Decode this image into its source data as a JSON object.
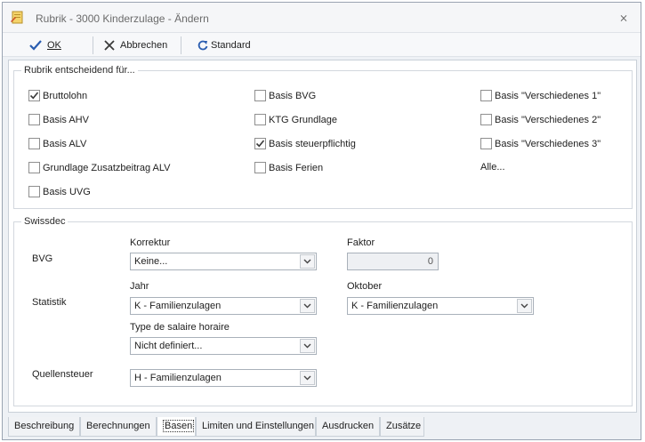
{
  "window": {
    "title": "Rubrik - 3000 Kinderzulage - Ändern",
    "close_glyph": "⨯"
  },
  "toolbar": {
    "ok_label": "OK",
    "cancel_label": "Abbrechen",
    "standard_label": "Standard"
  },
  "group1": {
    "legend": "Rubrik entscheidend für...",
    "checkboxes": [
      {
        "label": "Bruttolohn",
        "checked": true
      },
      {
        "label": "Basis AHV",
        "checked": false
      },
      {
        "label": "Basis ALV",
        "checked": false
      },
      {
        "label": "Grundlage Zusatzbeitrag ALV",
        "checked": false
      },
      {
        "label": "Basis UVG",
        "checked": false
      },
      {
        "label": "Basis BVG",
        "checked": false
      },
      {
        "label": "KTG Grundlage",
        "checked": false
      },
      {
        "label": "Basis steuerpflichtig",
        "checked": true
      },
      {
        "label": "Basis Ferien",
        "checked": false
      },
      {
        "label": "Basis \"Verschiedenes 1\"",
        "checked": false
      },
      {
        "label": "Basis \"Verschiedenes 2\"",
        "checked": false
      },
      {
        "label": "Basis \"Verschiedenes 3\"",
        "checked": false
      }
    ],
    "all_link": "Alle..."
  },
  "swissdec": {
    "legend": "Swissdec",
    "bvg_label": "BVG",
    "korrektur_label": "Korrektur",
    "korrektur_value": "Keine...",
    "faktor_label": "Faktor",
    "faktor_value": "0",
    "statistik_label": "Statistik",
    "jahr_label": "Jahr",
    "jahr_value": "K - Familienzulagen",
    "oktober_label": "Oktober",
    "oktober_value": "K - Familienzulagen",
    "type_label": "Type de salaire horaire",
    "type_value": "Nicht definiert...",
    "quellensteuer_label": "Quellensteuer",
    "quellensteuer_value": "H - Familienzulagen"
  },
  "tabs": [
    {
      "label": "Beschreibung",
      "active": false
    },
    {
      "label": "Berechnungen",
      "active": false
    },
    {
      "label": "Basen",
      "active": true
    },
    {
      "label": "Limiten und Einstellungen",
      "active": false
    },
    {
      "label": "Ausdrucken",
      "active": false
    },
    {
      "label": "Zusätze",
      "active": false
    }
  ],
  "colors": {
    "accent_blue": "#2a5db0",
    "check_color": "#3a3a3a"
  }
}
